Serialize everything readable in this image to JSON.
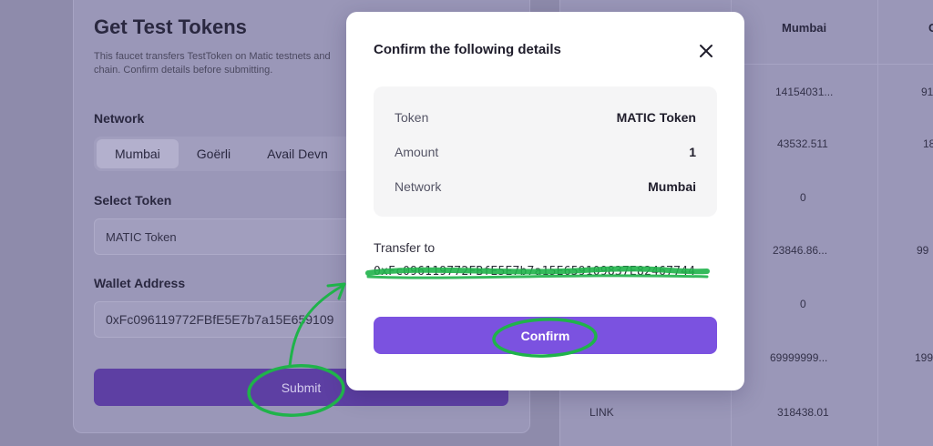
{
  "faucet": {
    "title": "Get Test Tokens",
    "description": "This faucet transfers TestToken on Matic testnets and chain. Confirm details before submitting.",
    "network_label": "Network",
    "networks": [
      "Mumbai",
      "Goërli",
      "Avail Devn"
    ],
    "active_network": "Mumbai",
    "select_token_label": "Select Token",
    "token_value": "MATIC Token",
    "wallet_label": "Wallet Address",
    "wallet_value": "0xFc096119772FBfE5E7b7a15E659109",
    "submit_label": "Submit"
  },
  "table": {
    "columns": [
      "Mumbai",
      "G"
    ],
    "rows": [
      {
        "token": "",
        "mumbai": "14154031...",
        "next": "91"
      },
      {
        "token": "",
        "mumbai": "43532.511",
        "next": "18"
      },
      {
        "token": "",
        "mumbai": "0",
        "next": ""
      },
      {
        "token": "",
        "mumbai": "23846.86...",
        "next": "99"
      },
      {
        "token": "",
        "mumbai": "0",
        "next": ""
      },
      {
        "token": "",
        "mumbai": "69999999...",
        "next": "199"
      },
      {
        "token": "LINK",
        "mumbai": "318438.01",
        "next": ""
      }
    ]
  },
  "modal": {
    "title": "Confirm the following details",
    "details": [
      {
        "key": "Token",
        "value": "MATIC Token"
      },
      {
        "key": "Amount",
        "value": "1"
      },
      {
        "key": "Network",
        "value": "Mumbai"
      }
    ],
    "transfer_label": "Transfer to",
    "address": "0xFc096119772FBfE5E7b7a15E659109837E82467744",
    "confirm_label": "Confirm"
  },
  "annotation_color": "#1fb34a",
  "accent_color": "#7b52e0"
}
